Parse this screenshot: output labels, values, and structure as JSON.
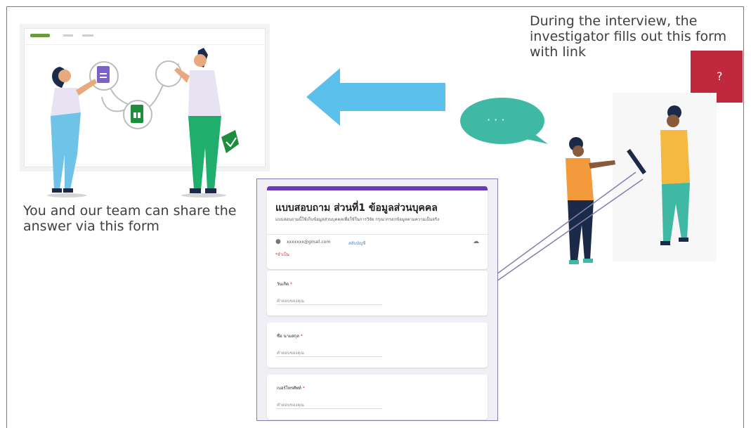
{
  "left_caption": "You and our team can share the answer via this form",
  "right_caption": "During the interview, the investigator fills out this form with link",
  "question_bubble": "?",
  "speech_bubble": "· · ·",
  "form": {
    "title": "แบบสอบถาม ส่วนที่1 ข้อมูลส่วนบุคคล",
    "description": "แบบสอบถามนี้ใช้เก็บข้อมูลส่วนบุคคลเพื่อใช้ในการวิจัย กรุณากรอกข้อมูลตามความเป็นจริง",
    "email": "xxxxxxx@gmail.com",
    "switch_account": "สลับบัญชี",
    "required_note": "*จำเป็น",
    "questions": [
      {
        "label": "วันเกิด",
        "answer": "คำตอบของคุณ"
      },
      {
        "label": "ชื่อ นามสกุล",
        "answer": "คำตอบของคุณ"
      },
      {
        "label": "เบอร์โทรศัพท์",
        "answer": "คำตอบของคุณ"
      }
    ]
  },
  "colors": {
    "arrow": "#5bc0eb",
    "speech_bubble": "#3fb8a4",
    "question_bubble": "#c0283e",
    "form_accent": "#673ab7",
    "sheets_green": "#1e8e3e",
    "docs_purple": "#7b61c9"
  }
}
